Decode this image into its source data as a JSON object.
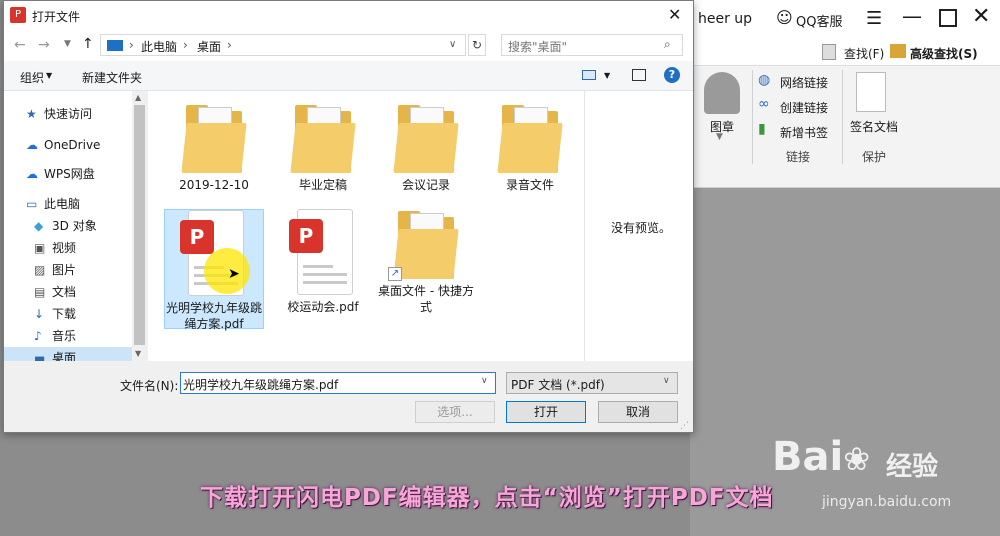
{
  "app": {
    "title_partial": "heer up",
    "qq_service": "QQ客服",
    "find_label": "查找(F)",
    "advanced_find_label": "高级查找(S)",
    "ribbon": {
      "image_label": "图章",
      "net_link": "网络链接",
      "create_link": "创建链接",
      "new_bookmark": "新增书签",
      "link_group": "链接",
      "sign_doc": "签名文档",
      "protect_group": "保护"
    }
  },
  "dialog": {
    "title": "打开文件",
    "breadcrumb": [
      "此电脑",
      "桌面"
    ],
    "search_placeholder": "搜索\"桌面\"",
    "toolbar": {
      "organize": "组织",
      "new_folder": "新建文件夹"
    },
    "nav": [
      {
        "label": "快速访问",
        "icon": "star-icon"
      },
      {
        "label": "OneDrive",
        "icon": "cloud-icon"
      },
      {
        "label": "WPS网盘",
        "icon": "wps-cloud-icon"
      },
      {
        "label": "此电脑",
        "icon": "computer-icon"
      },
      {
        "label": "3D 对象",
        "icon": "cube-icon"
      },
      {
        "label": "视频",
        "icon": "video-icon"
      },
      {
        "label": "图片",
        "icon": "picture-icon"
      },
      {
        "label": "文档",
        "icon": "document-icon"
      },
      {
        "label": "下载",
        "icon": "download-icon"
      },
      {
        "label": "音乐",
        "icon": "music-icon"
      },
      {
        "label": "桌面",
        "icon": "desktop-icon"
      }
    ],
    "files": [
      {
        "name": "2019-12-10",
        "type": "folder"
      },
      {
        "name": "毕业定稿",
        "type": "folder"
      },
      {
        "name": "会议记录",
        "type": "folder"
      },
      {
        "name": "录音文件",
        "type": "folder"
      },
      {
        "name": "光明学校九年级跳绳方案.pdf",
        "type": "pdf"
      },
      {
        "name": "校运动会.pdf",
        "type": "pdf"
      },
      {
        "name": "桌面文件 - 快捷方式",
        "type": "shortcut"
      }
    ],
    "preview_text": "没有预览。",
    "filename_label": "文件名(N):",
    "filename_value": "光明学校九年级跳绳方案.pdf",
    "filetype_value": "PDF 文档 (*.pdf)",
    "options_button": "选项...",
    "open_button": "打开",
    "cancel_button": "取消"
  },
  "caption": "下载打开闪电PDF编辑器，点击“浏览”打开PDF文档",
  "watermark": {
    "brand": "Bai",
    "brand_cn": "经验",
    "url": "jingyan.baidu.com"
  }
}
